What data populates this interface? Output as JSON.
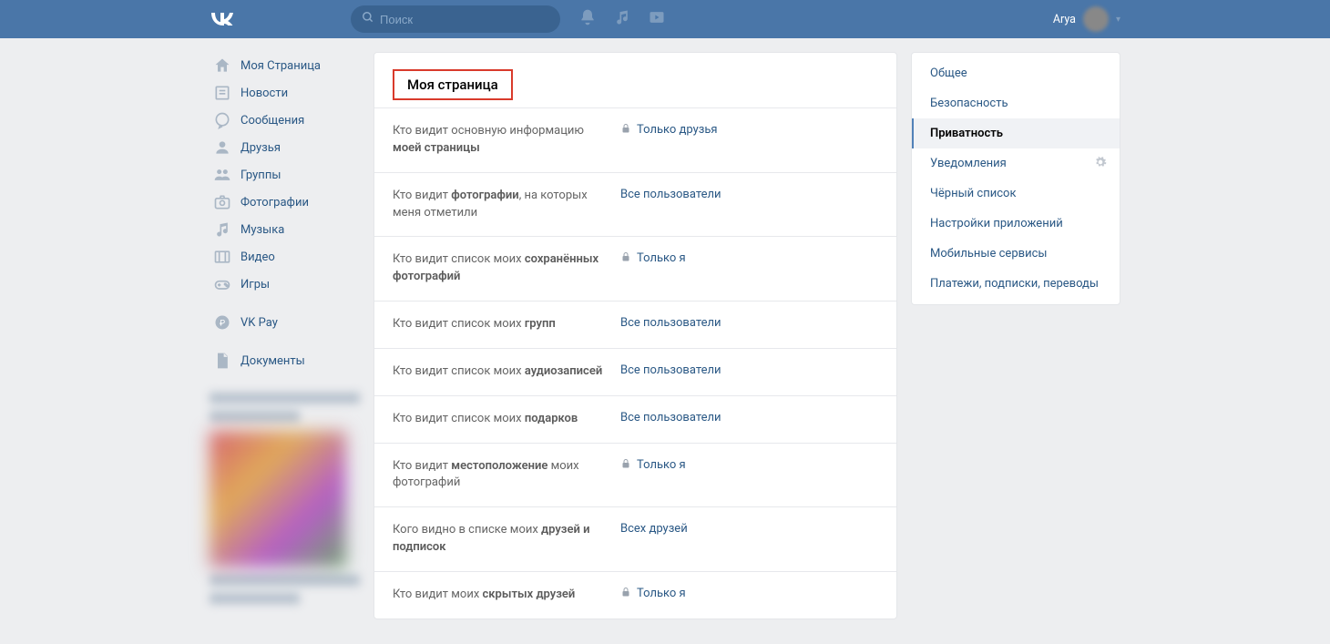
{
  "header": {
    "search_placeholder": "Поиск",
    "username": "Arya"
  },
  "sidebar": {
    "items": [
      {
        "icon": "home",
        "label": "Моя Страница"
      },
      {
        "icon": "news",
        "label": "Новости"
      },
      {
        "icon": "msg",
        "label": "Сообщения"
      },
      {
        "icon": "friends",
        "label": "Друзья"
      },
      {
        "icon": "groups",
        "label": "Группы"
      },
      {
        "icon": "photos",
        "label": "Фотографии"
      },
      {
        "icon": "music",
        "label": "Музыка"
      },
      {
        "icon": "video",
        "label": "Видео"
      },
      {
        "icon": "games",
        "label": "Игры"
      }
    ],
    "items2": [
      {
        "icon": "pay",
        "label": "VK Pay"
      }
    ],
    "items3": [
      {
        "icon": "docs",
        "label": "Документы"
      }
    ]
  },
  "main": {
    "section_title": "Моя страница",
    "rows": [
      {
        "label_pre": "Кто видит основную информацию ",
        "label_bold": "моей страницы",
        "value": "Только друзья",
        "locked": true
      },
      {
        "label_pre": "Кто видит ",
        "label_bold": "фотографии",
        "label_post": ", на которых меня отметили",
        "value": "Все пользователи",
        "locked": false
      },
      {
        "label_pre": "Кто видит список моих ",
        "label_bold": "сохранённых фотографий",
        "value": "Только я",
        "locked": true
      },
      {
        "label_pre": "Кто видит список моих ",
        "label_bold": "групп",
        "value": "Все пользователи",
        "locked": false
      },
      {
        "label_pre": "Кто видит список моих ",
        "label_bold": "аудиозаписей",
        "value": "Все пользователи",
        "locked": false
      },
      {
        "label_pre": "Кто видит список моих ",
        "label_bold": "подарков",
        "value": "Все пользователи",
        "locked": false
      },
      {
        "label_pre": "Кто видит ",
        "label_bold": "местоположение",
        "label_post": " моих фотографий",
        "value": "Только я",
        "locked": true
      },
      {
        "label_pre": "Кого видно в списке моих ",
        "label_bold": "друзей и подписок",
        "value": "Всех друзей",
        "locked": false
      },
      {
        "label_pre": "Кто видит моих ",
        "label_bold": "скрытых друзей",
        "value": "Только я",
        "locked": true
      }
    ]
  },
  "right_panel": {
    "items": [
      {
        "label": "Общее",
        "active": false,
        "gear": false
      },
      {
        "label": "Безопасность",
        "active": false,
        "gear": false
      },
      {
        "label": "Приватность",
        "active": true,
        "gear": false
      },
      {
        "label": "Уведомления",
        "active": false,
        "gear": true
      },
      {
        "label": "Чёрный список",
        "active": false,
        "gear": false
      },
      {
        "label": "Настройки приложений",
        "active": false,
        "gear": false
      },
      {
        "label": "Мобильные сервисы",
        "active": false,
        "gear": false
      },
      {
        "label": "Платежи, подписки, переводы",
        "active": false,
        "gear": false
      }
    ]
  }
}
